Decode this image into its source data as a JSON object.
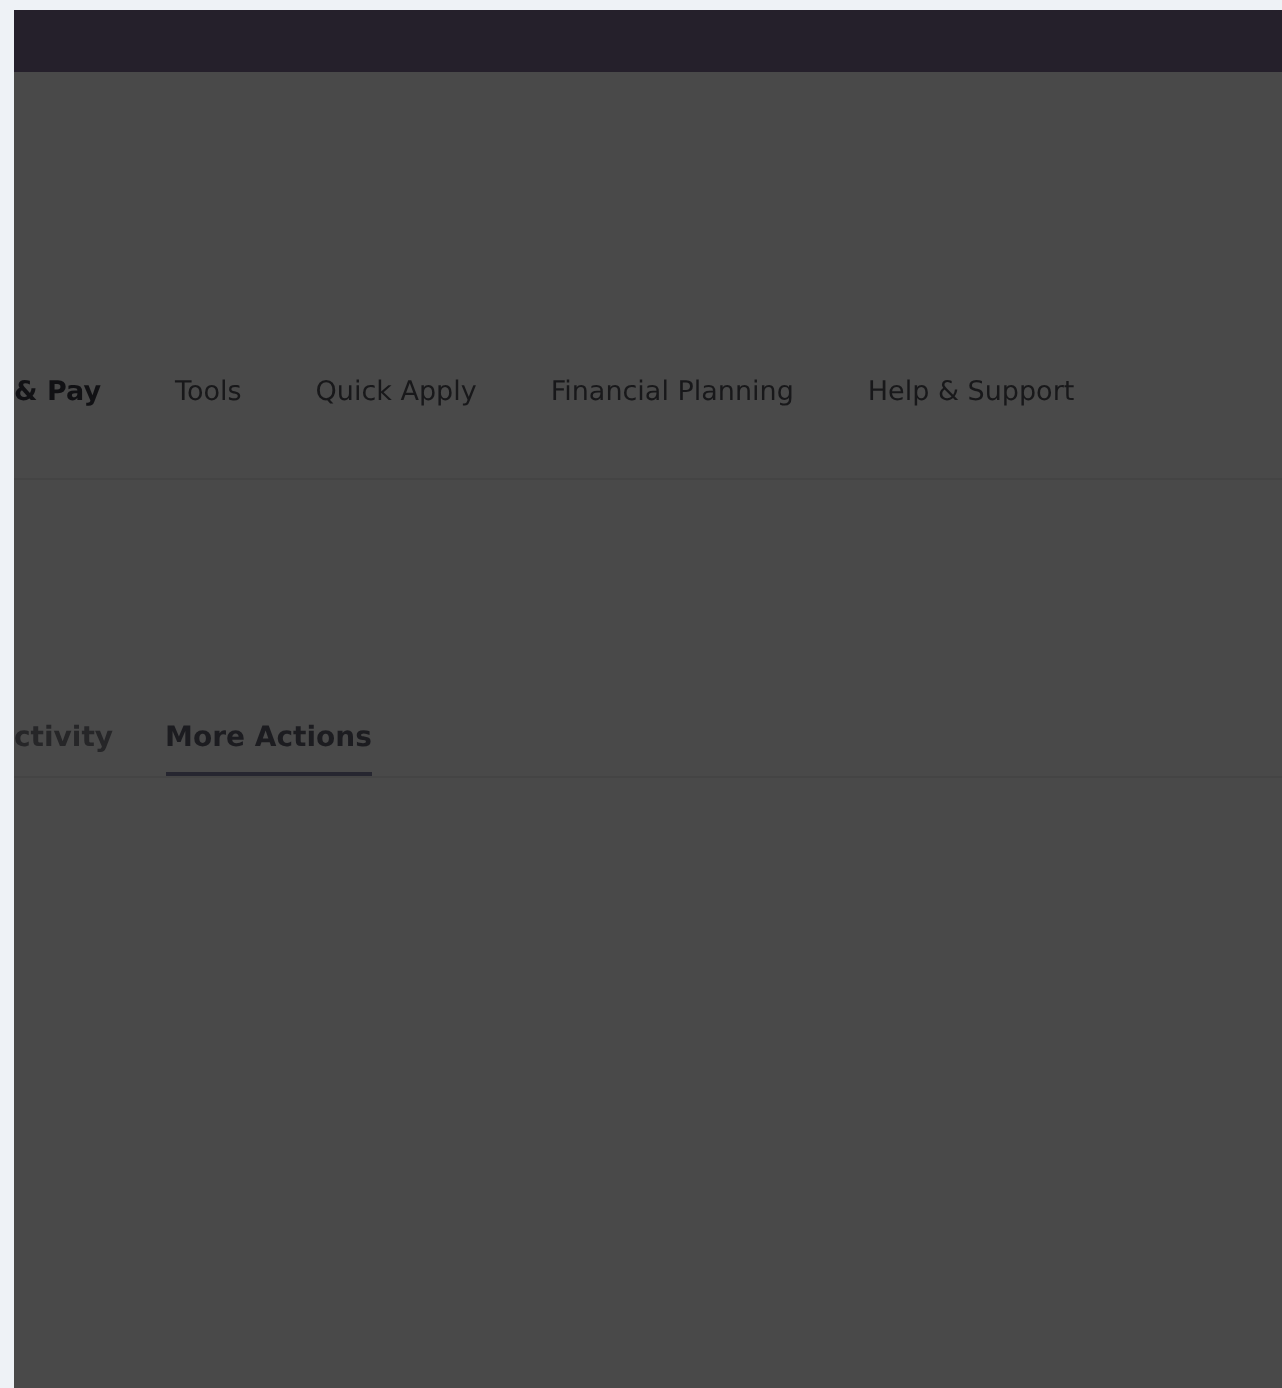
{
  "nav": [
    {
      "label": "& Pay",
      "selected": true
    },
    {
      "label": "Tools",
      "selected": false
    },
    {
      "label": "Quick Apply",
      "selected": false
    },
    {
      "label": "Financial Planning",
      "selected": false
    },
    {
      "label": "Help & Support",
      "selected": false
    }
  ],
  "tabs": [
    {
      "label": "ctivity",
      "selected": false
    },
    {
      "label": "More Actions",
      "selected": true
    }
  ]
}
